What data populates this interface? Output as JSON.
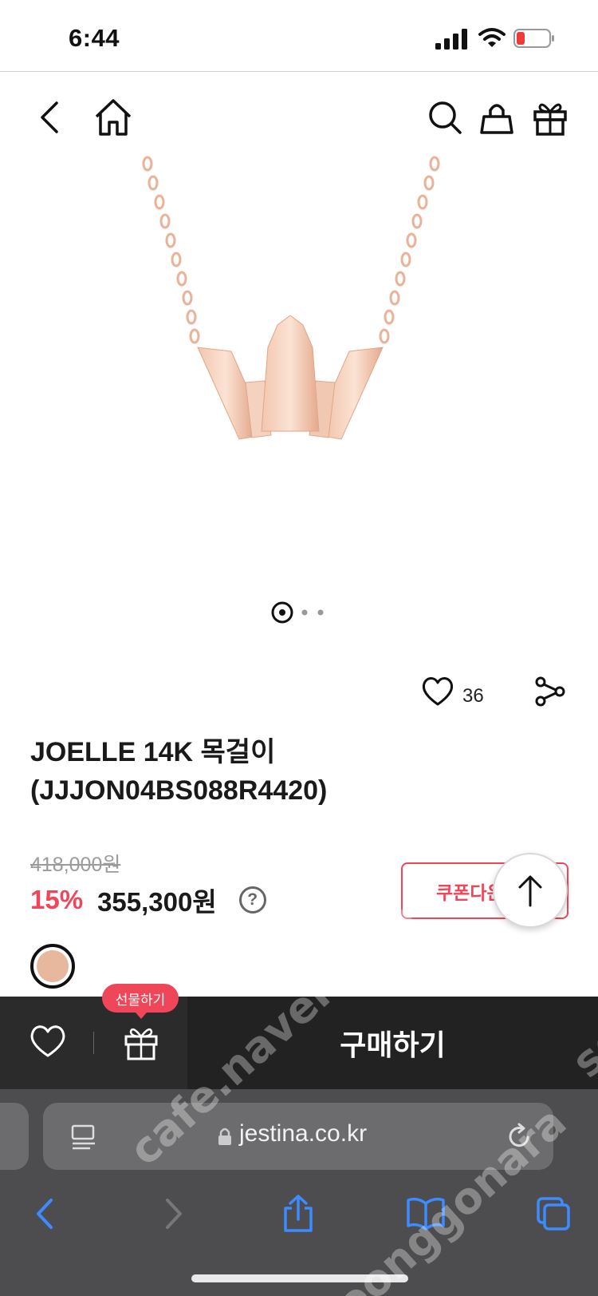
{
  "status_bar": {
    "time": "6:44"
  },
  "nav": {
    "icons": [
      "back-icon",
      "home-icon",
      "search-icon",
      "cart-icon",
      "gift-icon"
    ]
  },
  "product": {
    "title_line1": "JOELLE 14K 목걸이",
    "title_line2": "(JJJON04BS088R4420)",
    "like_count": "36",
    "original_price": "418,000원",
    "discount": "15%",
    "sale_price": "355,300원",
    "help_symbol": "?",
    "coupon_label": "쿠폰다운로드",
    "carousel": {
      "total": 3,
      "active": 1
    },
    "color_swatch": "#e7b89d"
  },
  "purchase_bar": {
    "gift_tooltip": "선물하기",
    "buy_label": "구매하기"
  },
  "browser": {
    "url": "jestina.co.kr"
  },
  "watermarks": [
    "cafe.naver.com",
    "sdc",
    "joonggonara"
  ],
  "colors": {
    "accent": "#f0465a",
    "dark_bar": "#222222",
    "browser_chrome": "#4d4d4f"
  }
}
